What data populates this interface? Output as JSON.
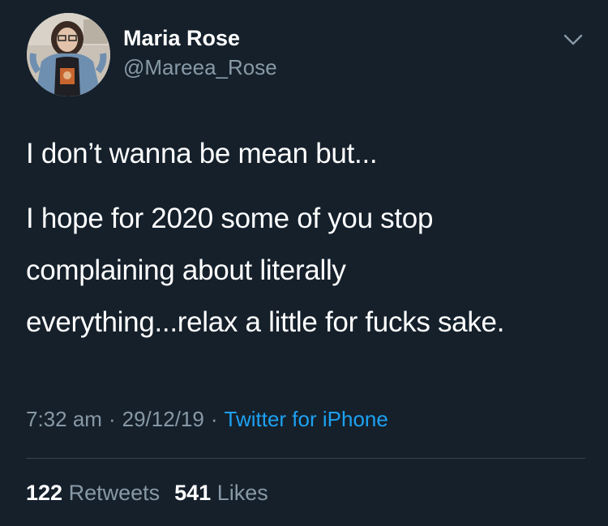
{
  "user": {
    "display_name": "Maria Rose",
    "handle": "@Mareea_Rose",
    "avatar_icon": "profile-photo"
  },
  "menu_icon": "chevron-down-icon",
  "tweet": {
    "lines": [
      "I don’t wanna be mean but...",
      "I hope for 2020 some of you stop",
      "complaining about literally",
      "everything...relax a little for fucks sake."
    ]
  },
  "meta": {
    "time": "7:32 am",
    "separator": "·",
    "date": "29/12/19",
    "source": "Twitter for iPhone"
  },
  "stats": {
    "retweets_count": "122",
    "retweets_label": "Retweets",
    "likes_count": "541",
    "likes_label": "Likes"
  },
  "colors": {
    "background": "#15202b",
    "primary_text": "#ffffff",
    "secondary_text": "#8899a6",
    "accent": "#1da1f2",
    "divider": "#38444d"
  }
}
